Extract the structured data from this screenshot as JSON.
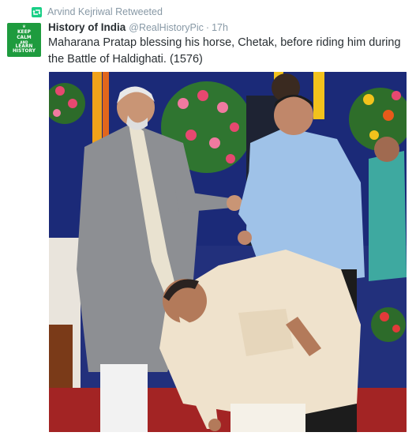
{
  "retweet": {
    "icon": "retweet-icon",
    "text": "Arvind Kejriwal Retweeted"
  },
  "author": {
    "avatar": {
      "lines": [
        "KEEP",
        "CALM",
        "AND",
        "LEARN",
        "HISTORY"
      ],
      "color": "#1e9b3e"
    },
    "fullname": "History of India",
    "username": "@RealHistoryPic",
    "separator": "·",
    "time": "17h"
  },
  "tweet": {
    "text": "Maharana Pratap blessing his horse, Chetak, before riding him during the Battle of Haldighati. (1576)"
  },
  "media": {
    "icon": "photo-icon"
  },
  "colors": {
    "secondary_text": "#8899a6",
    "primary_text": "#292f33",
    "retweet_green": "#19cf86"
  }
}
